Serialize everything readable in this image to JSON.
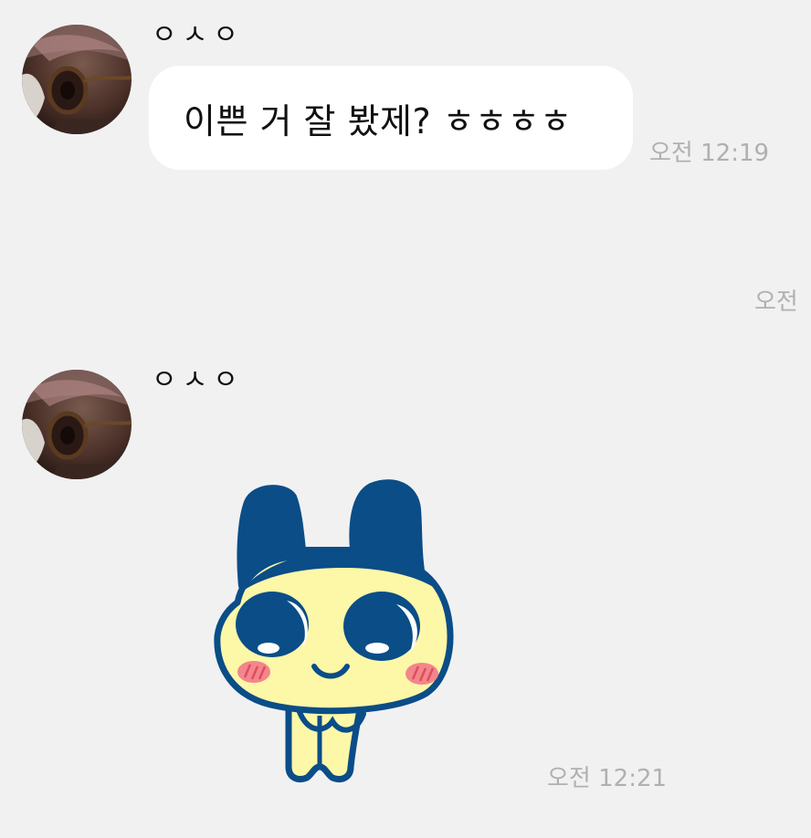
{
  "messages": [
    {
      "sender": "ㅇㅅㅇ",
      "text": "이쁜 거 잘 봤제? ㅎㅎㅎㅎ",
      "time": "오전 12:19"
    },
    {
      "sender": "ㅇㅅㅇ",
      "sticker": "mametchi-sticker",
      "time": "오전 12:21"
    }
  ],
  "partial_time": "오전",
  "colors": {
    "background": "#f1f1f2",
    "bubble": "#ffffff",
    "timestamp": "#b0b0b3",
    "sticker_blue": "#0a4d87",
    "sticker_yellow": "#fdf7a8",
    "sticker_blush": "#f2868c"
  }
}
